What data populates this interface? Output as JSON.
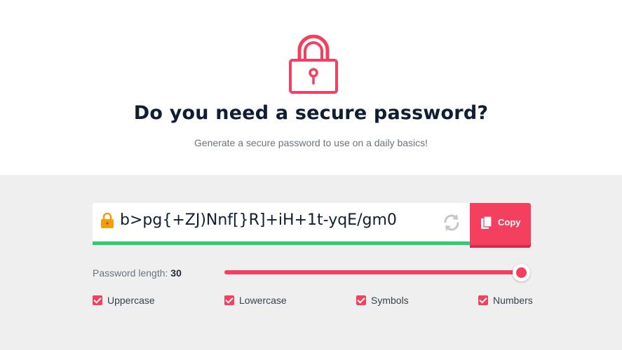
{
  "hero": {
    "title": "Do you need a secure password?",
    "subtitle": "Generate a secure password to use on a daily basics!",
    "icon": "padlock-icon"
  },
  "generator": {
    "password": "b>pg{+ZJ)Nnf[}R]+iH+1t-yqE/gm0",
    "strength_color": "#2ecc71",
    "copy_label": "Copy",
    "length_label": "Password length:",
    "length_value": "30",
    "length_slider_fraction": 1.0
  },
  "options": [
    {
      "label": "Uppercase",
      "checked": true
    },
    {
      "label": "Lowercase",
      "checked": true
    },
    {
      "label": "Symbols",
      "checked": true
    },
    {
      "label": "Numbers",
      "checked": true
    }
  ],
  "colors": {
    "accent": "#f43f5e",
    "heading": "#0f1e33",
    "panel_bg": "#efefef",
    "strength_good": "#2ecc71",
    "lock_orange": "#f59e0b"
  }
}
